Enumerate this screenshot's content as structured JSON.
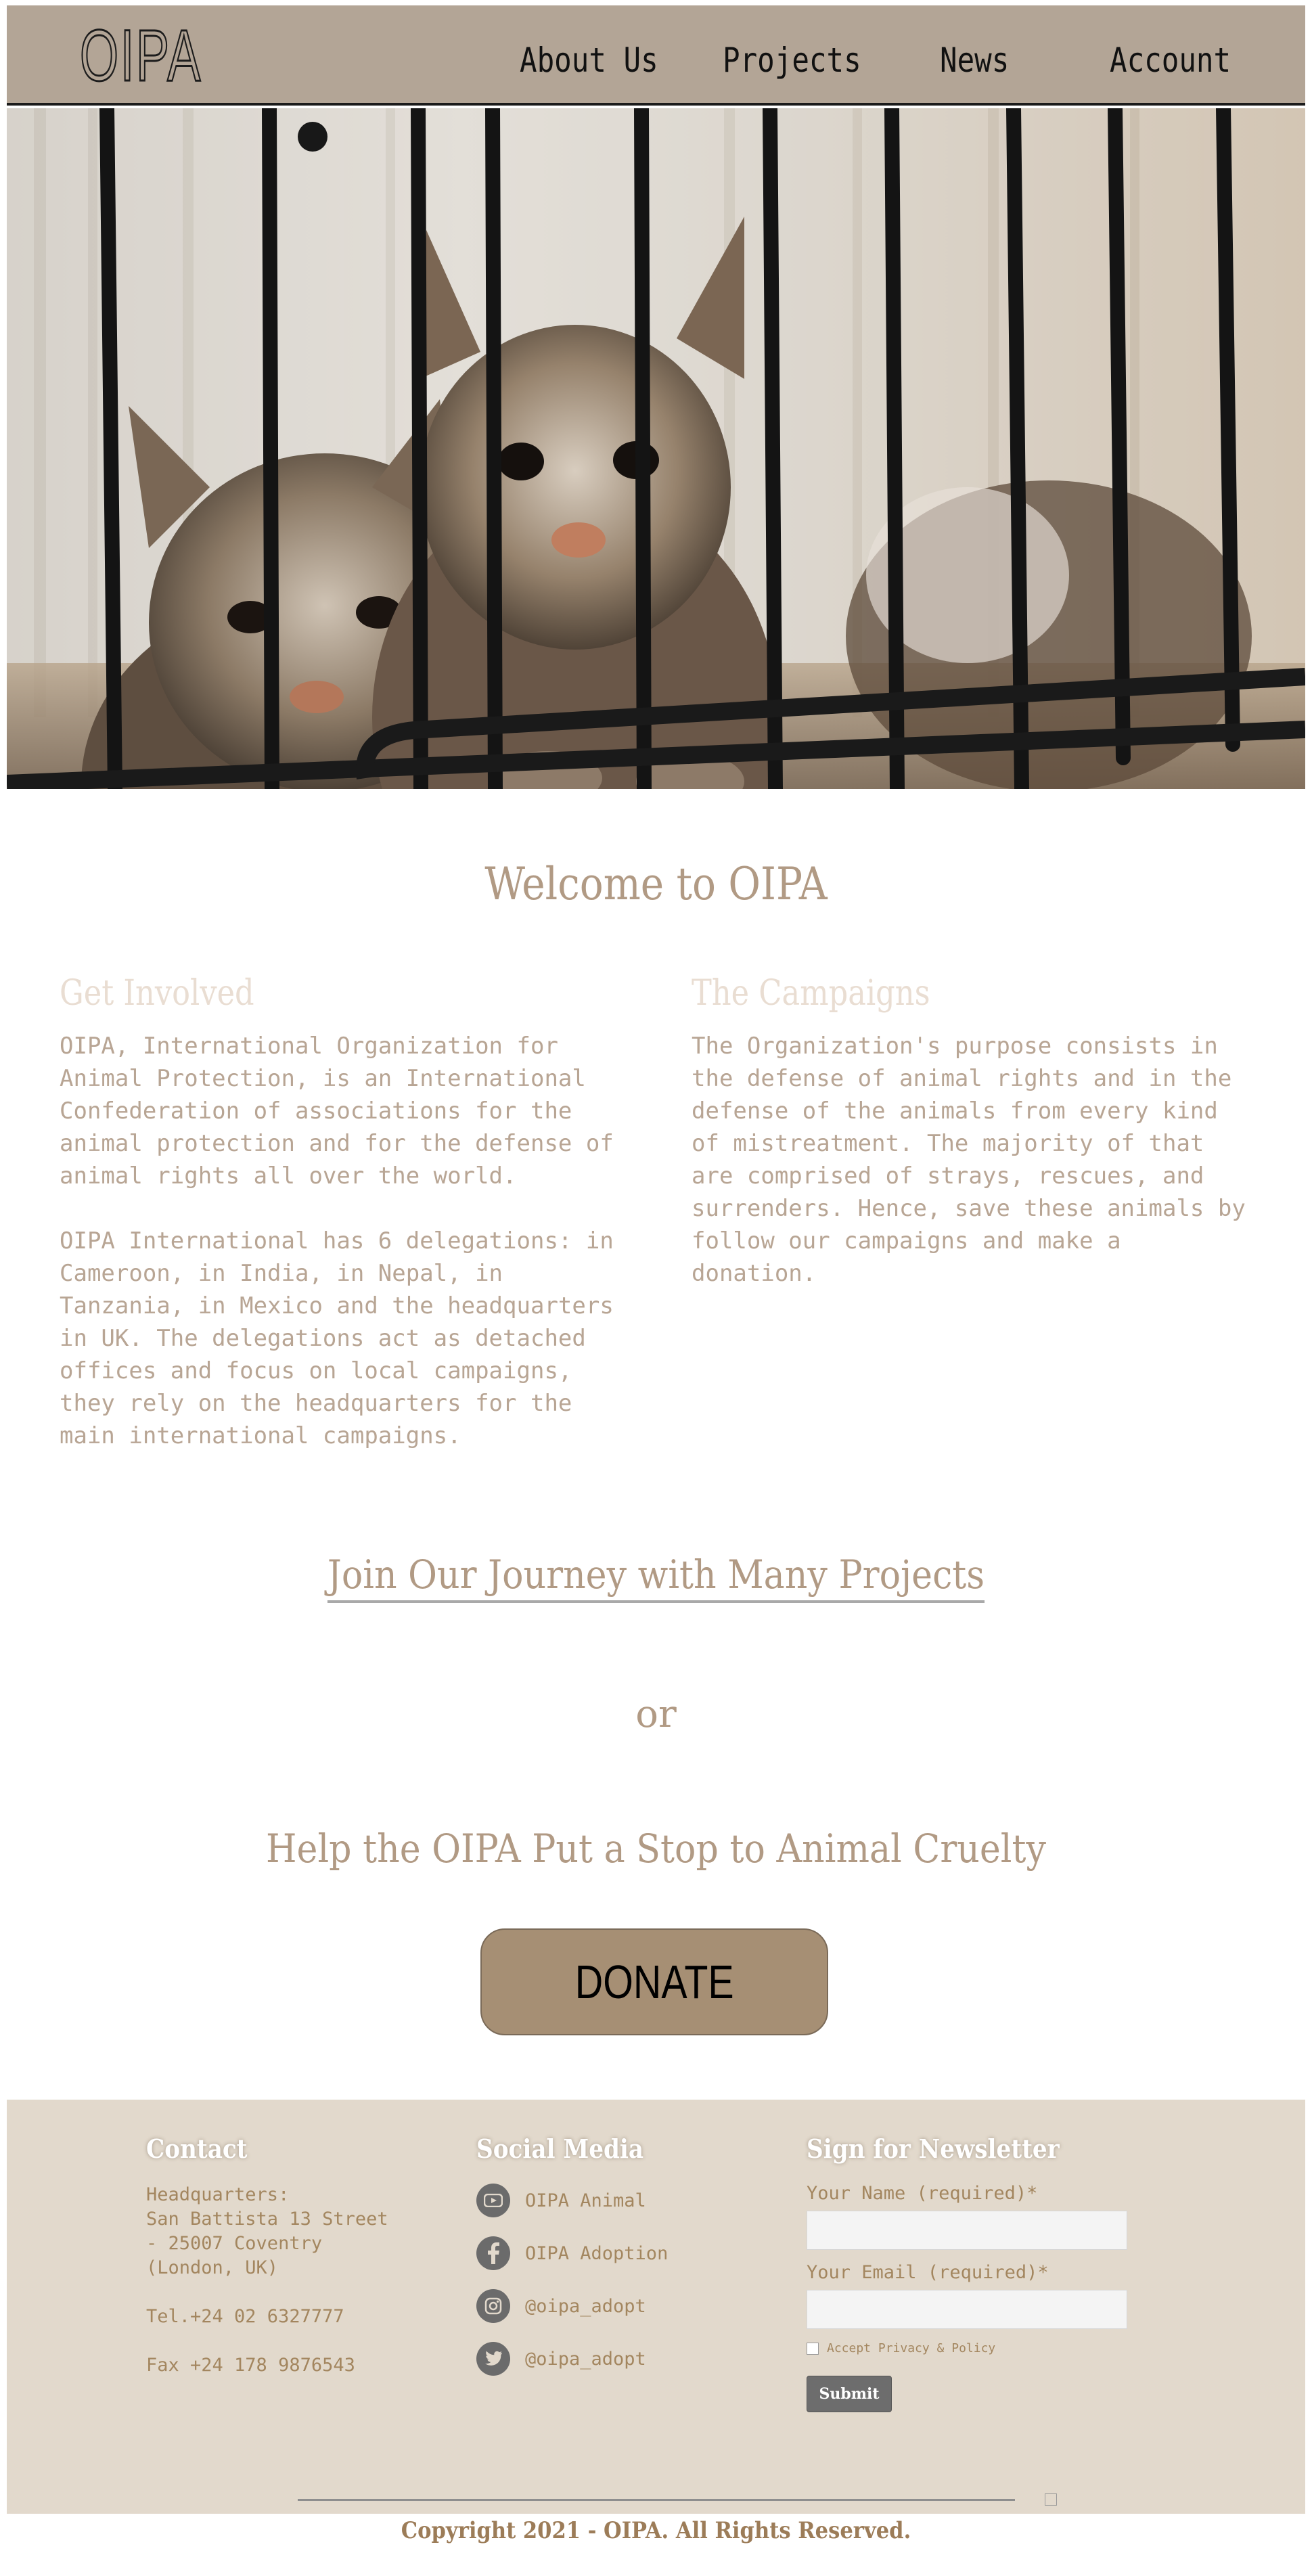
{
  "brand": {
    "logo": "OIPA"
  },
  "nav": {
    "about": "About Us",
    "projects": "Projects",
    "news": "News",
    "account": "Account"
  },
  "hero": {
    "alt": "kittens behind cage bars"
  },
  "welcome": {
    "title": "Welcome to OIPA"
  },
  "get_involved": {
    "title": "Get Involved",
    "p1": "OIPA, International Organization for\nAnimal Protection, is an International\nConfederation of associations for the\nanimal protection and for the defense of\nanimal rights all over the world.",
    "p2": "OIPA International has 6 delegations: in\nCameroon, in India, in Nepal, in\nTanzania, in Mexico and the headquarters\nin UK. The delegations act as detached\noffices and focus on local campaigns,\nthey rely on the headquarters for the\nmain international campaigns."
  },
  "campaigns": {
    "title": "The Campaigns",
    "p1": "The Organization's purpose consists in\nthe defense of animal rights and in the\ndefense of the animals from every kind\nof mistreatment. The majority of that\nare comprised of strays, rescues, and\nsurrenders. Hence, save these animals by\nfollow our campaigns and make a\ndonation."
  },
  "cta": {
    "join": "Join Our Journey with Many Projects",
    "or": "or",
    "help": "Help the OIPA Put a Stop to Animal Cruelty",
    "donate": "DONATE"
  },
  "footer": {
    "contact": {
      "title": "Contact",
      "address": "Headquarters:\nSan Battista 13 Street\n- 25007 Coventry\n(London, UK)",
      "tel": "Tel.+24 02 6327777",
      "fax": "Fax +24 178 9876543"
    },
    "social": {
      "title": "Social Media",
      "items": [
        {
          "icon": "youtube-icon",
          "label": "OIPA Animal"
        },
        {
          "icon": "facebook-icon",
          "label": "OIPA Adoption"
        },
        {
          "icon": "instagram-icon",
          "label": "@oipa_adopt"
        },
        {
          "icon": "twitter-icon",
          "label": "@oipa_adopt"
        }
      ]
    },
    "newsletter": {
      "title": "Sign for Newsletter",
      "name_label": "Your Name (required)*",
      "email_label": "Your Email (required)*",
      "privacy": "Accept Privacy & Policy",
      "submit": "Submit"
    },
    "copyright": "Copyright 2021 - OIPA. All Rights Reserved."
  },
  "colors": {
    "header_bg": "#b3a596",
    "accent_text": "#b19a84",
    "donate_bg": "#a68f74",
    "footer_bg": "#e2d9cc",
    "footer_text": "#a3865f"
  }
}
